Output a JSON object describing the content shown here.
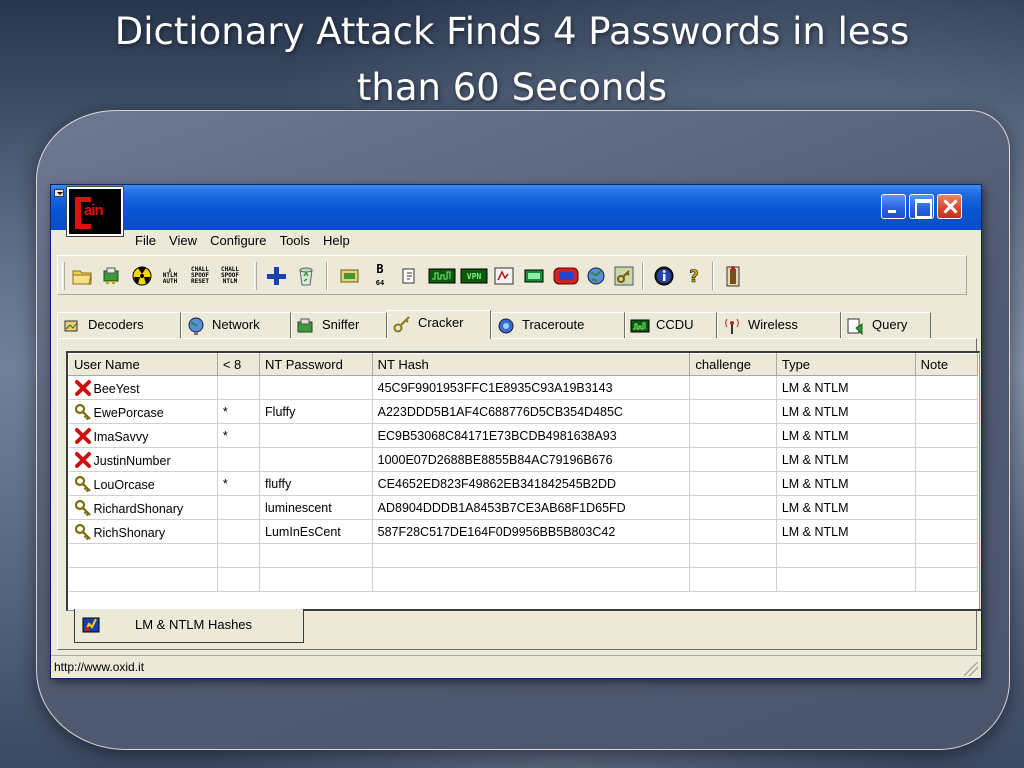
{
  "slide": {
    "title_line1": "Dictionary Attack Finds 4 Passwords in less",
    "title_line2": "than 60 Seconds"
  },
  "window": {
    "logo_text": "ain",
    "menu": [
      "File",
      "View",
      "Configure",
      "Tools",
      "Help"
    ],
    "status_text": "http://www.oxid.it"
  },
  "toolbar": {
    "ntlm_auth": [
      "NTLM",
      "AUTH"
    ],
    "chall_spoof_reset": [
      "CHALL",
      "SPOOF",
      "RESET"
    ],
    "chall_spoof_ntlm": [
      "CHALL",
      "SPOOF",
      "NTLM"
    ],
    "b64_label": "B",
    "b64_sub": "64"
  },
  "tabs": [
    {
      "label": "Decoders"
    },
    {
      "label": "Network"
    },
    {
      "label": "Sniffer"
    },
    {
      "label": "Cracker"
    },
    {
      "label": "Traceroute"
    },
    {
      "label": "CCDU"
    },
    {
      "label": "Wireless"
    },
    {
      "label": "Query"
    }
  ],
  "active_tab": "Cracker",
  "table": {
    "columns": [
      "User Name",
      "< 8",
      "NT Password",
      "NT Hash",
      "challenge",
      "Type",
      "Note"
    ],
    "rows": [
      {
        "icon": "red-x",
        "user": "BeeYest",
        "lt8": "",
        "password": "",
        "hash": "45C9F9901953FFC1E8935C93A19B3143",
        "challenge": "",
        "type": "LM & NTLM",
        "note": ""
      },
      {
        "icon": "key",
        "user": "EwePorcase",
        "lt8": "*",
        "password": "Fluffy",
        "hash": "A223DDD5B1AF4C688776D5CB354D485C",
        "challenge": "",
        "type": "LM & NTLM",
        "note": ""
      },
      {
        "icon": "red-x",
        "user": "ImaSavvy",
        "lt8": "*",
        "password": "",
        "hash": "EC9B53068C84171E73BCDB4981638A93",
        "challenge": "",
        "type": "LM & NTLM",
        "note": ""
      },
      {
        "icon": "red-x",
        "user": "JustinNumber",
        "lt8": "",
        "password": "",
        "hash": "1000E07D2688BE8855B84AC79196B676",
        "challenge": "",
        "type": "LM & NTLM",
        "note": ""
      },
      {
        "icon": "key",
        "user": "LouOrcase",
        "lt8": "*",
        "password": "fluffy",
        "hash": "CE4652ED823F49862EB341842545B2DD",
        "challenge": "",
        "type": "LM & NTLM",
        "note": ""
      },
      {
        "icon": "key",
        "user": "RichardShonary",
        "lt8": "",
        "password": "luminescent",
        "hash": "AD8904DDDB1A8453B7CE3AB68F1D65FD",
        "challenge": "",
        "type": "LM & NTLM",
        "note": ""
      },
      {
        "icon": "key",
        "user": "RichShonary",
        "lt8": "",
        "password": "LumInEsCent",
        "hash": "587F28C517DE164F0D9956BB5B803C42",
        "challenge": "",
        "type": "LM & NTLM",
        "note": ""
      }
    ]
  },
  "bottom_tab": {
    "label": "LM & NTLM Hashes"
  },
  "colors": {
    "accent_red": "#e01010",
    "xp_titlebar": "#0a55d4",
    "window_face": "#ece9d8"
  }
}
